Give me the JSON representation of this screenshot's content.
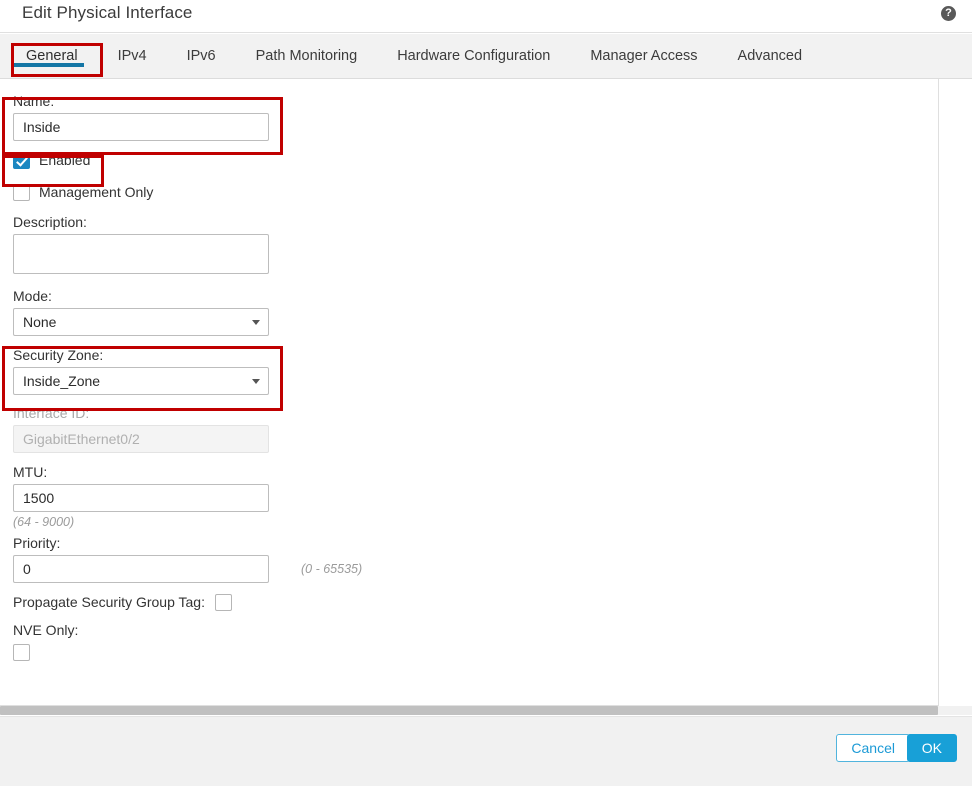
{
  "header": {
    "title": "Edit Physical Interface",
    "help_icon": "help-circle-icon",
    "help_glyph": "?"
  },
  "tabs": [
    {
      "label": "General",
      "active": true
    },
    {
      "label": "IPv4",
      "active": false
    },
    {
      "label": "IPv6",
      "active": false
    },
    {
      "label": "Path Monitoring",
      "active": false
    },
    {
      "label": "Hardware Configuration",
      "active": false
    },
    {
      "label": "Manager Access",
      "active": false
    },
    {
      "label": "Advanced",
      "active": false
    }
  ],
  "form": {
    "name": {
      "label": "Name:",
      "value": "Inside",
      "placeholder": ""
    },
    "enabled": {
      "label": "Enabled",
      "checked": true
    },
    "management_only": {
      "label": "Management Only",
      "checked": false
    },
    "description": {
      "label": "Description:",
      "value": "",
      "placeholder": ""
    },
    "mode": {
      "label": "Mode:",
      "value": "None",
      "caret": "chevron-down-icon"
    },
    "security_zone": {
      "label": "Security Zone:",
      "value": "Inside_Zone",
      "caret": "chevron-down-icon"
    },
    "interface_id": {
      "label": "Interface ID:",
      "value": "GigabitEthernet0/2",
      "disabled": true
    },
    "mtu": {
      "label": "MTU:",
      "value": "1500",
      "hint": "(64 - 9000)"
    },
    "priority": {
      "label": "Priority:",
      "value": "0",
      "hint": "(0 - 65535)"
    },
    "propagate_sgt": {
      "label": "Propagate Security Group Tag:",
      "checked": false
    },
    "nve_only": {
      "label": "NVE Only:",
      "checked": false
    }
  },
  "footer": {
    "cancel_label": "Cancel",
    "ok_label": "OK"
  },
  "colors": {
    "tab_underline": "#1476a5",
    "checkbox_checked": "#1b87c1",
    "ok_button": "#18a0d7",
    "cancel_text": "#1c9ad6",
    "annotation": "#c00000",
    "scrollbar_thumb": "#c0c0c0"
  }
}
